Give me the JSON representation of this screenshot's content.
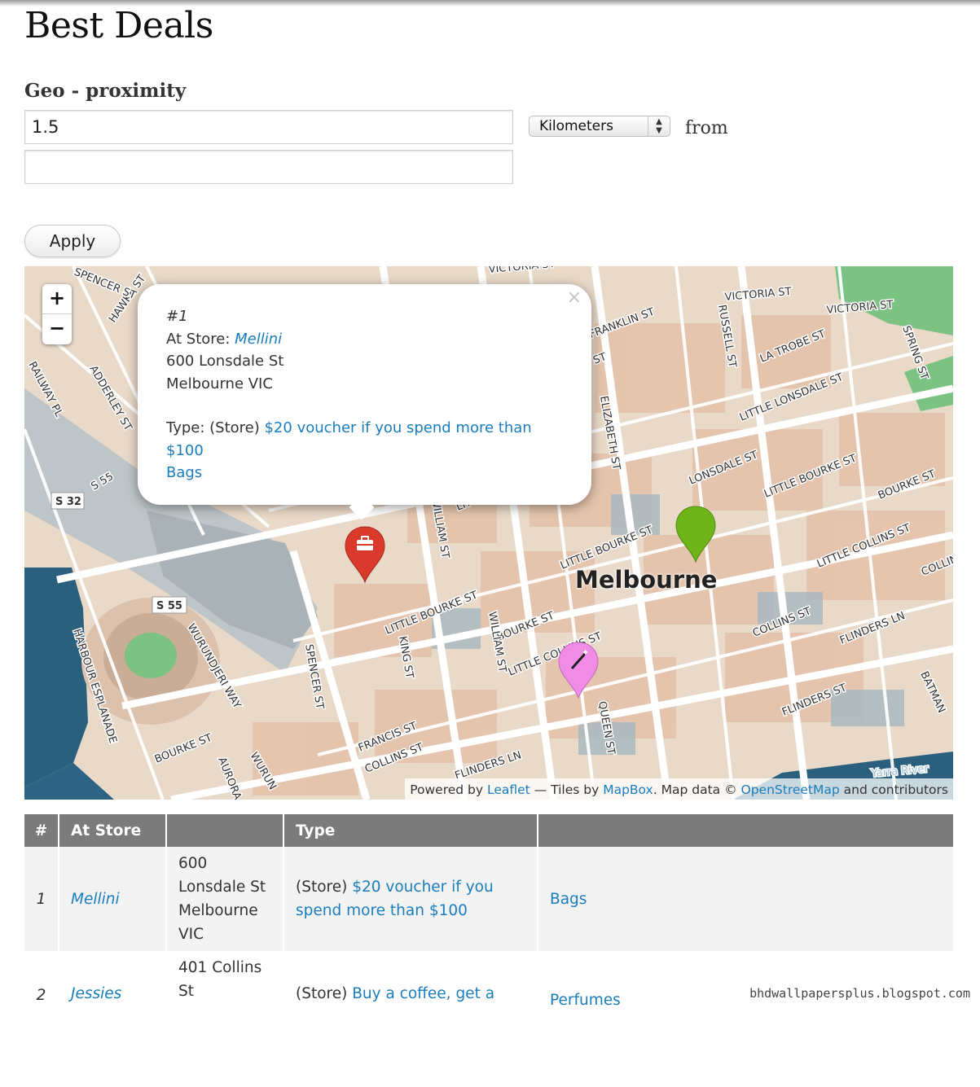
{
  "page": {
    "title": "Best Deals"
  },
  "filter": {
    "label": "Geo - proximity",
    "distance_value": "1.5",
    "origin_value": "",
    "unit_selected": "Kilometers",
    "from_label": "from",
    "apply_label": "Apply"
  },
  "map": {
    "zoom_in": "+",
    "zoom_out": "−",
    "city_label": "Melbourne",
    "street_labels": [
      "VICTORIA ST",
      "FRANKLIN ST",
      "RUSSELL ST",
      "LA TROBE ST",
      "LITTLE LONSDALE ST",
      "SPRING ST",
      "LONSDALE ST",
      "LITTLE BOURKE ST",
      "BOURKE ST",
      "LITTLE COLLINS ST",
      "COLLINS ST",
      "FLINDERS LN",
      "FLINDERS ST",
      "ELIZABETH ST",
      "WILLIAM ST",
      "KING ST",
      "SPENCER ST",
      "QUEEN ST",
      "FRANCIS ST",
      "HARBOUR ESPLANADE",
      "WURUNDJERI WAY",
      "ADDERLEY ST",
      "RAILWAY PL",
      "HAWKE ST",
      "SPENCER ST",
      "S 55",
      "S 32",
      "S 55",
      "AURORA",
      "BOURKE ST",
      "Yarra River"
    ],
    "markers": [
      {
        "name": "store-marker",
        "color": "#d93a2b",
        "icon": "briefcase-icon"
      },
      {
        "name": "green-marker",
        "color": "#6fb51a",
        "icon": ""
      },
      {
        "name": "pink-marker",
        "color": "#f08be6",
        "icon": "magic-wand-icon"
      }
    ],
    "popup": {
      "close": "×",
      "number": "#1",
      "store_prefix": "At Store: ",
      "store_name": "Mellini",
      "address_line1": "600 Lonsdale St",
      "address_line2": "Melbourne VIC",
      "type_prefix": "Type: (Store) ",
      "deal_line1": "$20 voucher if you spend more than",
      "deal_line2": "$100",
      "category": "Bags"
    },
    "attribution": {
      "powered": "Powered by ",
      "leaflet": "Leaflet",
      "tiles": " — Tiles by ",
      "mapbox": "MapBox",
      "mapdata": ". Map data © ",
      "osm": "OpenStreetMap",
      "contrib": " and contributors"
    }
  },
  "table": {
    "headers": [
      "#",
      "At Store",
      "",
      "Type",
      ""
    ],
    "rows": [
      {
        "num": "1",
        "store": "Mellini",
        "addr": [
          "600",
          "Lonsdale St",
          "Melbourne",
          "VIC"
        ],
        "type_prefix": "(Store) ",
        "deal_a": "$20 voucher if you",
        "deal_b": "spend more than $100",
        "category": "Bags"
      },
      {
        "num": "2",
        "store": "Jessies",
        "addr": [
          "401 Collins",
          "St"
        ],
        "type_prefix": "(Store) ",
        "deal_a": "Buy a coffee, get a",
        "category": "Perfumes"
      }
    ]
  },
  "watermark": "bhdwallpapersplus.blogspot.com",
  "colors": {
    "link": "#1a7dbd",
    "header_bg": "#7b7b7b",
    "water": "#2a5f7e",
    "park": "#7cc283",
    "building": "#e8c9b5"
  }
}
